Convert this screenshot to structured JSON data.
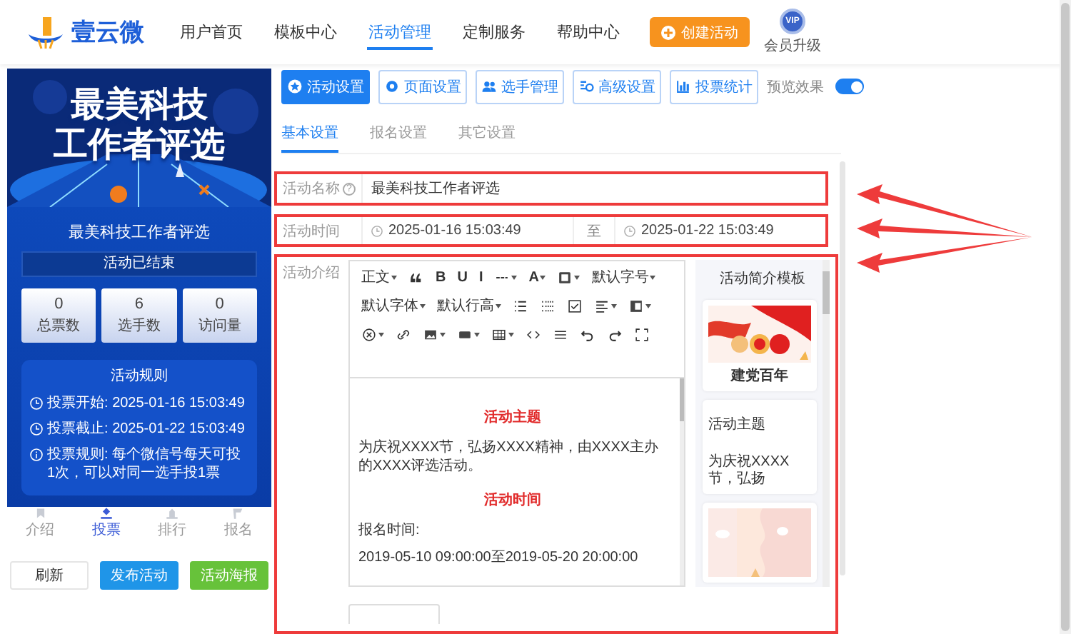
{
  "header": {
    "logo": "壹云微",
    "nav": [
      {
        "label": "用户首页",
        "selected": false
      },
      {
        "label": "模板中心",
        "selected": false
      },
      {
        "label": "活动管理",
        "selected": true
      },
      {
        "label": "定制服务",
        "selected": false
      },
      {
        "label": "帮助中心",
        "selected": false
      }
    ],
    "create_button": "创建活动",
    "vip_badge": "VIP",
    "vip_label": "会员升级"
  },
  "preview": {
    "banner_title": [
      "最美科技",
      "工作者评选"
    ],
    "activity_title": "最美科技工作者评选",
    "status": "活动已结束",
    "stats": [
      {
        "value": "0",
        "label": "总票数"
      },
      {
        "value": "6",
        "label": "选手数"
      },
      {
        "value": "0",
        "label": "访问量"
      }
    ],
    "rules_title": "活动规则",
    "rules": [
      {
        "kind": "clock",
        "label": "投票开始:",
        "value": "2025-01-16 15:03:49"
      },
      {
        "kind": "clock",
        "label": "投票截止:",
        "value": "2025-01-22 15:03:49"
      },
      {
        "kind": "info",
        "label": "投票规则:",
        "value": "每个微信号每天可投1次，可以对同一选手投1票"
      }
    ],
    "tabs": [
      {
        "label": "介绍",
        "selected": false
      },
      {
        "label": "投票",
        "selected": true
      },
      {
        "label": "排行",
        "selected": false
      },
      {
        "label": "报名",
        "selected": false
      }
    ]
  },
  "actions": [
    {
      "label": "刷新",
      "kind": "plain"
    },
    {
      "label": "发布活动",
      "kind": "primary"
    },
    {
      "label": "活动海报",
      "kind": "success"
    }
  ],
  "settings_tabs": [
    {
      "label": "活动设置",
      "selected": true
    },
    {
      "label": "页面设置",
      "selected": false
    },
    {
      "label": "选手管理",
      "selected": false
    },
    {
      "label": "高级设置",
      "selected": false
    },
    {
      "label": "投票统计",
      "selected": false
    }
  ],
  "preview_toggle": {
    "label": "预览效果",
    "on": true
  },
  "sub_tabs": [
    {
      "label": "基本设置",
      "selected": true
    },
    {
      "label": "报名设置",
      "selected": false
    },
    {
      "label": "其它设置",
      "selected": false
    }
  ],
  "form": {
    "name": {
      "label": "活动名称",
      "help": "?",
      "value": "最美科技工作者评选"
    },
    "time": {
      "label": "活动时间",
      "start": "2025-01-16 15:03:49",
      "separator": "至",
      "end": "2025-01-22 15:03:49"
    },
    "intro": {
      "label": "活动介绍"
    }
  },
  "editor": {
    "toolbar": [
      {
        "kind": "text",
        "label": "正文",
        "dropdown": true
      },
      {
        "kind": "icon",
        "dropdown": false
      },
      {
        "kind": "glyph",
        "label": "B",
        "dropdown": false
      },
      {
        "kind": "glyph",
        "label": "U",
        "dropdown": false
      },
      {
        "kind": "glyph",
        "label": "I",
        "dropdown": false
      },
      {
        "kind": "icon",
        "dropdown": true
      },
      {
        "kind": "glyph",
        "label": "A",
        "dropdown": true
      },
      {
        "kind": "icon",
        "dropdown": true
      },
      {
        "kind": "text",
        "label": "默认字号",
        "dropdown": true
      },
      {
        "kind": "text",
        "label": "默认字体",
        "dropdown": true
      },
      {
        "kind": "text",
        "label": "默认行高",
        "dropdown": true
      },
      {
        "kind": "icon",
        "dropdown": false
      },
      {
        "kind": "icon",
        "dropdown": false
      },
      {
        "kind": "icon",
        "dropdown": false
      },
      {
        "kind": "icon",
        "dropdown": true
      },
      {
        "kind": "icon",
        "dropdown": true
      },
      {
        "kind": "icon",
        "dropdown": true
      },
      {
        "kind": "icon",
        "dropdown": false
      },
      {
        "kind": "icon",
        "dropdown": true
      },
      {
        "kind": "icon",
        "dropdown": true
      },
      {
        "kind": "icon",
        "dropdown": true
      },
      {
        "kind": "icon",
        "dropdown": false
      },
      {
        "kind": "icon",
        "dropdown": false
      },
      {
        "kind": "icon",
        "dropdown": false
      },
      {
        "kind": "icon",
        "dropdown": false
      },
      {
        "kind": "icon",
        "dropdown": false
      }
    ],
    "content": [
      {
        "kind": "heading",
        "text": "活动主题"
      },
      {
        "kind": "paragraph",
        "text": "为庆祝XXXX节，弘扬XXXX精神，由XXXX主办的XXXX评选活动。"
      },
      {
        "kind": "heading",
        "text": "活动时间"
      },
      {
        "kind": "paragraph",
        "text": "报名时间:"
      },
      {
        "kind": "paragraph",
        "text": "2019-05-10 09:00:00至2019-05-20 20:00:00"
      }
    ]
  },
  "templates": {
    "title": "活动简介模板",
    "items": [
      {
        "kind": "flag",
        "caption": "建党百年"
      },
      {
        "kind": "text",
        "title": "活动主题",
        "excerpt": "为庆祝XXXX节，弘扬"
      },
      {
        "kind": "waves"
      }
    ]
  }
}
